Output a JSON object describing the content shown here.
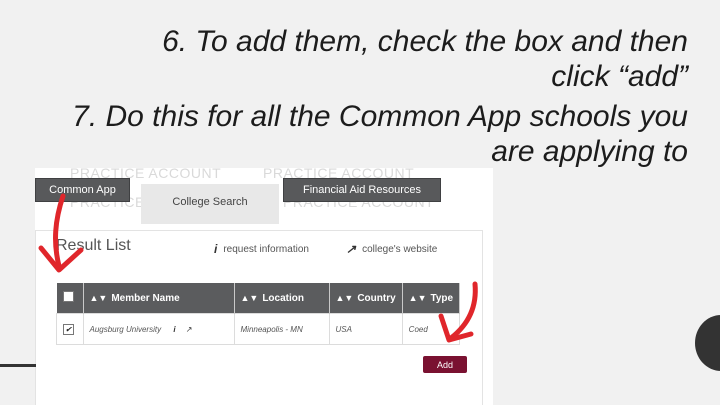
{
  "instructions": {
    "step6_line1": "6. To add them, check the box and then",
    "step6_line2": "click “add”",
    "step7_line1": "7. Do this for all the Common App schools you",
    "step7_line2": "are applying to"
  },
  "watermark": "PRACTICE ACCOUNT",
  "nav": {
    "tab_common_app": "Common App",
    "tab_college_search": "College Search",
    "tab_financial_aid": "Financial Aid Resources"
  },
  "results": {
    "title": "Result List",
    "legend_info_label": "request information",
    "legend_info_icon": "i",
    "legend_website_label": "college's website",
    "legend_website_icon": "↗",
    "columns": [
      "Member Name",
      "Location",
      "Country",
      "Type"
    ],
    "rows": [
      {
        "checked": true,
        "name": "Augsburg University",
        "location": "Minneapolis - MN",
        "country": "USA",
        "type": "Coed"
      }
    ],
    "add_label": "Add"
  },
  "colors": {
    "accent": "#7a1131",
    "arrow": "#e0262b",
    "nav_bg": "#58595b"
  }
}
